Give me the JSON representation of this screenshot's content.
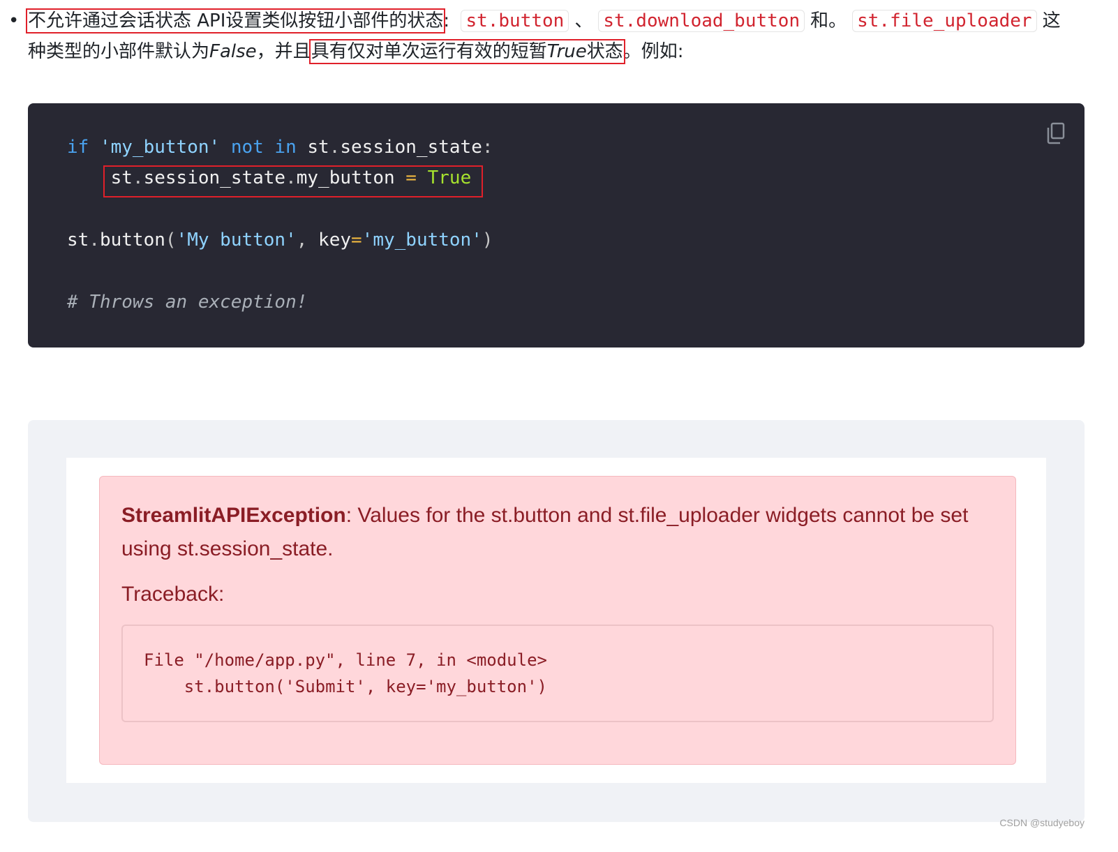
{
  "paragraph": {
    "bullet": "•",
    "part1_highlighted": "不允许通过会话状态 API设置类似按钮小部件的状态",
    "colon": ":",
    "code1": "st.button",
    "sep1": "、",
    "code2": "st.download_button",
    "sep2": "和。",
    "code3": "st.file_uploader",
    "part2": "这",
    "line2_a": "种类型的小部件默认为",
    "line2_false": "False",
    "line2_b": "，并且",
    "line2_highlight_a": "具有仅对单次运行有效的短暂",
    "line2_true": "True",
    "line2_highlight_b": "状态",
    "line2_c": "。例如:"
  },
  "code_block": {
    "line1": {
      "kw_if": "if",
      "str_key": "'my_button'",
      "kw_not_in": "not in",
      "target": "st",
      "dot": ".",
      "attr": "session_state",
      "colon": ":"
    },
    "line2": {
      "indent": "    ",
      "obj": "st",
      "dot1": ".",
      "attr1": "session_state",
      "dot2": ".",
      "attr2": "my_button",
      "eq": "=",
      "val": "True"
    },
    "line3": {
      "obj": "st",
      "dot": ".",
      "fn": "button",
      "lp": "(",
      "arg": "'My button'",
      "comma": ",",
      "kwarg": "key",
      "eq": "=",
      "kwval": "'my_button'",
      "rp": ")"
    },
    "line4": "# Throws an exception!",
    "copy_icon": "copy-icon"
  },
  "error_panel": {
    "title": "StreamlitAPIException",
    "message": ": Values for the st.button and st.file_uploader widgets cannot be set using st.session_state.",
    "traceback_label": "Traceback:",
    "traceback_line1": "File \"/home/app.py\", line 7, in <module>",
    "traceback_line2": "    st.button('Submit', key='my_button')"
  },
  "watermark": "CSDN @studyeboy"
}
